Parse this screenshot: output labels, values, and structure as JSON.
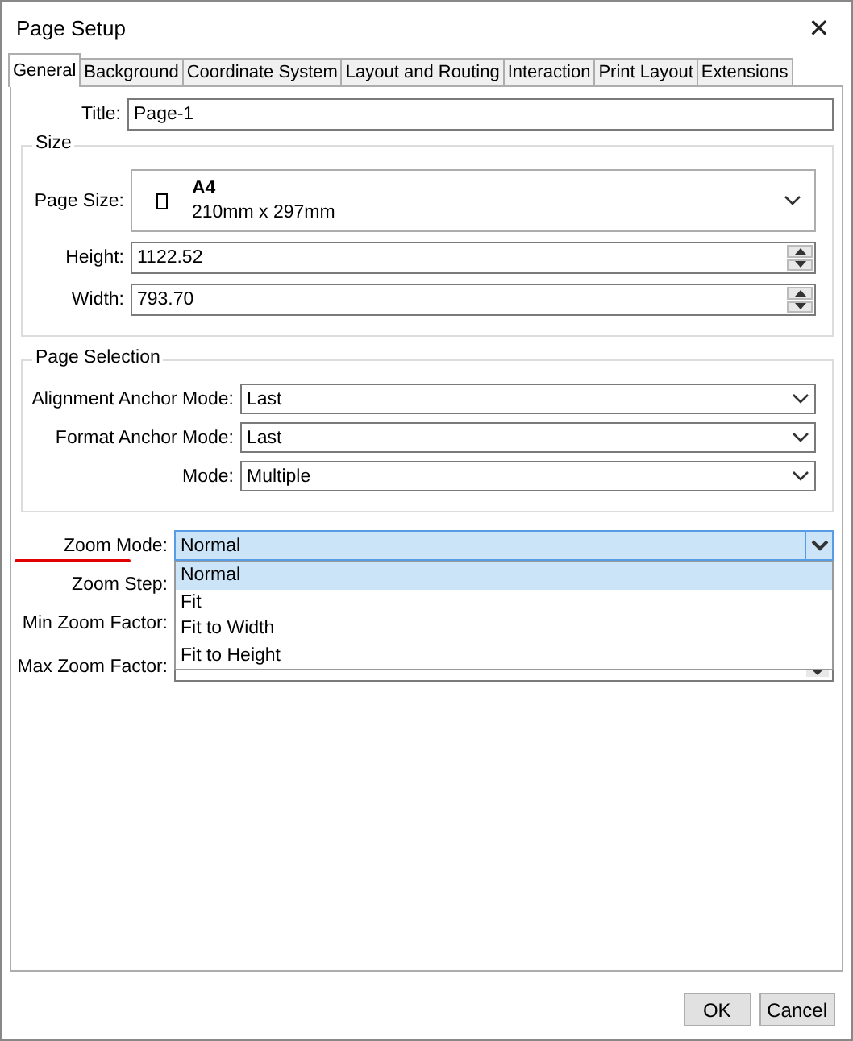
{
  "window": {
    "title": "Page Setup",
    "close": "✕"
  },
  "tabs": [
    {
      "label": "General",
      "selected": true
    },
    {
      "label": "Background",
      "selected": false
    },
    {
      "label": "Coordinate System",
      "selected": false
    },
    {
      "label": "Layout and Routing",
      "selected": false
    },
    {
      "label": "Interaction",
      "selected": false
    },
    {
      "label": "Print Layout",
      "selected": false
    },
    {
      "label": "Extensions",
      "selected": false
    }
  ],
  "title_field": {
    "label": "Title:",
    "value": "Page-1"
  },
  "size": {
    "heading": "Size",
    "page_size": {
      "label": "Page Size:",
      "name": "A4",
      "dimensions": "210mm x 297mm"
    },
    "fields": [
      {
        "label": "Height:",
        "value": "1122.52"
      },
      {
        "label": "Width:",
        "value": "793.70"
      }
    ]
  },
  "page_selection": {
    "heading": "Page Selection",
    "fields": [
      {
        "label": "Alignment Anchor Mode:",
        "value": "Last"
      },
      {
        "label": "Format Anchor Mode:",
        "value": "Last"
      },
      {
        "label": "Mode:",
        "value": "Multiple"
      }
    ]
  },
  "zoom": {
    "mode": {
      "label": "Zoom Mode:",
      "value": "Normal",
      "underlined": true,
      "expanded": true,
      "options": [
        {
          "label": "Normal",
          "selected": true
        },
        {
          "label": "Fit",
          "selected": false
        },
        {
          "label": "Fit to Width",
          "selected": false
        },
        {
          "label": "Fit to Height",
          "selected": false
        }
      ]
    },
    "hidden_labels": [
      "Zoom Step:",
      "Min Zoom Factor:",
      "Max Zoom Factor:"
    ]
  },
  "buttons": [
    "OK",
    "Cancel"
  ]
}
